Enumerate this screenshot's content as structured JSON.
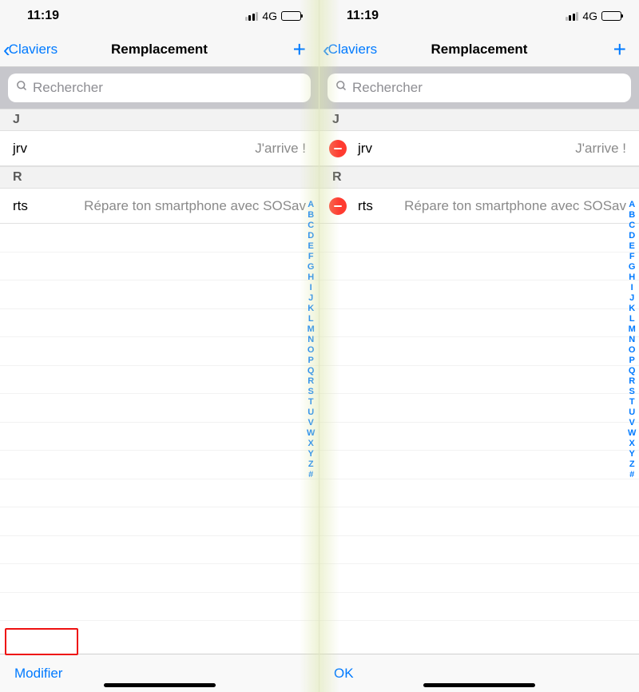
{
  "status": {
    "time": "11:19",
    "network": "4G"
  },
  "nav": {
    "back": "Claviers",
    "title": "Remplacement"
  },
  "search": {
    "placeholder": "Rechercher"
  },
  "sections": {
    "J": {
      "letter": "J",
      "shortcut": "jrv",
      "phrase": "J'arrive !"
    },
    "R": {
      "letter": "R",
      "shortcut": "rts",
      "phrase": "Répare ton smartphone avec SOSav"
    }
  },
  "index_letters": [
    "A",
    "B",
    "C",
    "D",
    "E",
    "F",
    "G",
    "H",
    "I",
    "J",
    "K",
    "L",
    "M",
    "N",
    "O",
    "P",
    "Q",
    "R",
    "S",
    "T",
    "U",
    "V",
    "W",
    "X",
    "Y",
    "Z",
    "#"
  ],
  "toolbar": {
    "left_edit": "Modifier",
    "right_ok": "OK"
  }
}
